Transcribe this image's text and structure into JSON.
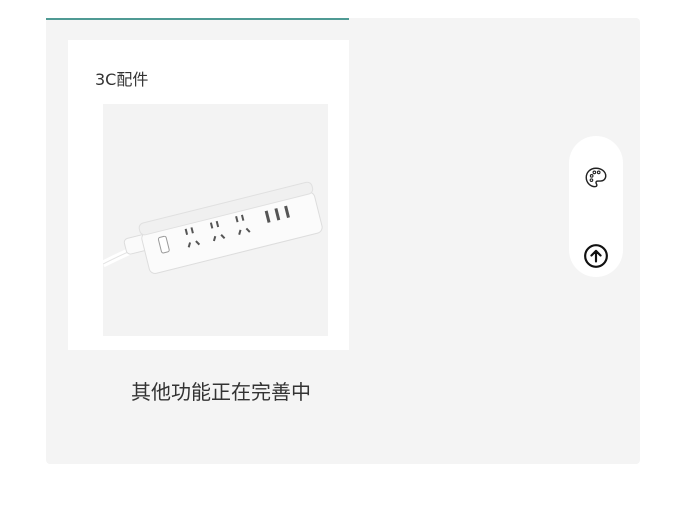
{
  "card": {
    "category": "3C配件",
    "image_icon": "power-strip-image"
  },
  "notice": "其他功能正在完善中",
  "float_bar": {
    "theme_icon": "palette-icon",
    "top_icon": "arrow-up-circle-icon"
  },
  "colors": {
    "accent_line": "#4f9a94",
    "panel_bg": "#f4f4f4",
    "card_bg": "#ffffff"
  }
}
